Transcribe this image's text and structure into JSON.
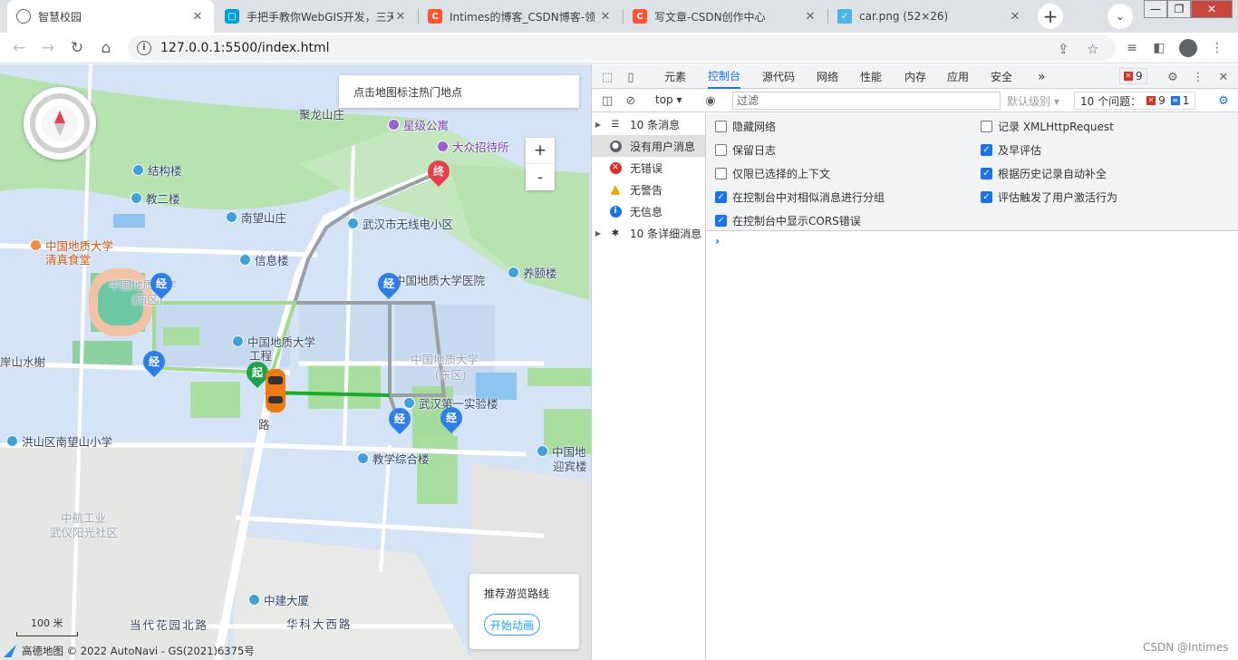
{
  "browser": {
    "tabs": [
      {
        "title": "智慧校园",
        "active": true,
        "favicon": "globe-icon"
      },
      {
        "title": "手把手教你WebGIS开发，三天",
        "favicon": "bilibili-icon"
      },
      {
        "title": "Intimes的博客_CSDN博客-领",
        "favicon": "csdn-icon"
      },
      {
        "title": "写文章-CSDN创作中心",
        "favicon": "csdn-icon"
      },
      {
        "title": "car.png (52×26)",
        "favicon": "image-icon"
      }
    ],
    "close_glyph": "✕",
    "new_tab_glyph": "+",
    "url": "127.0.0.1:5500/index.html",
    "colors": {
      "csdn": "#fc5531",
      "bili": "#00a1d6"
    }
  },
  "map": {
    "hint": "点击地图标注热门地点",
    "zoom_in": "+",
    "zoom_out": "-",
    "route_card": {
      "title": "推荐游览路线",
      "button": "开始动画"
    },
    "scale": "100 米",
    "copyright": "高德地图 © 2022 AutoNavi - GS(2021)6375号",
    "pois": [
      {
        "label": "聚龙山庄",
        "style": "plain"
      },
      {
        "label": "星级公寓",
        "style": "purple"
      },
      {
        "label": "大众招待所",
        "style": "purple"
      },
      {
        "label": "结构楼",
        "style": "blue"
      },
      {
        "label": "教二楼",
        "style": "blue"
      },
      {
        "label": "南望山庄",
        "style": "blue"
      },
      {
        "label": "武汉市无线电小区",
        "style": "blue"
      },
      {
        "label": "中国地质大学",
        "style": "orange"
      },
      {
        "label": "清真食堂",
        "style": "orange"
      },
      {
        "label": "信息楼",
        "style": "blue"
      },
      {
        "label": "中国地质大学医院",
        "style": "plain"
      },
      {
        "label": "养颐楼",
        "style": "blue"
      },
      {
        "label": "中国地质大学",
        "style": "plain"
      },
      {
        "label": "工程",
        "style": "plain"
      },
      {
        "label": "岸山水榭",
        "style": "plain"
      },
      {
        "label": "中国地质大学",
        "style": "gray"
      },
      {
        "label": "(西区)",
        "style": "gray"
      },
      {
        "label": "(东区)",
        "style": "gray"
      },
      {
        "label": "武汉第一实验楼",
        "style": "blue"
      },
      {
        "label": "洪山区南望山小学",
        "style": "blue"
      },
      {
        "label": "教学综合楼",
        "style": "blue"
      },
      {
        "label": "中国地",
        "style": "blue"
      },
      {
        "label": "迎宾楼",
        "style": "plain"
      },
      {
        "label": "中航工业",
        "style": "gray"
      },
      {
        "label": "武仪阳光社区",
        "style": "gray"
      },
      {
        "label": "中建大厦",
        "style": "blue"
      },
      {
        "label": "当代花园北路",
        "style": "plain"
      },
      {
        "label": "华科大西路",
        "style": "plain"
      },
      {
        "label": "路",
        "style": "plain"
      }
    ],
    "markers": {
      "end": "终",
      "start": "起",
      "via": "经"
    }
  },
  "devtools": {
    "tabs": [
      "元素",
      "控制台",
      "源代码",
      "网络",
      "性能",
      "内存",
      "应用",
      "安全"
    ],
    "more_tabs": "»",
    "active_tab": "控制台",
    "error_count": "9",
    "context": "top",
    "filter_placeholder": "过滤",
    "levels": "默认级别",
    "issues": {
      "label": "10 个问题：",
      "errors": "9",
      "info": "1"
    },
    "sidebar": [
      {
        "label": "10 条消息",
        "icon": "list-icon",
        "expandable": true
      },
      {
        "label": "没有用户消息",
        "icon": "user-icon",
        "selected": true
      },
      {
        "label": "无错误",
        "icon": "error-icon"
      },
      {
        "label": "无警告",
        "icon": "warning-icon"
      },
      {
        "label": "无信息",
        "icon": "info-icon"
      },
      {
        "label": "10 条详细消息",
        "icon": "bug-icon",
        "expandable": true
      }
    ],
    "settings_left": [
      {
        "label": "隐藏网络",
        "checked": false
      },
      {
        "label": "保留日志",
        "checked": false
      },
      {
        "label": "仅限已选择的上下文",
        "checked": false
      },
      {
        "label": "在控制台中对相似消息进行分组",
        "checked": true
      },
      {
        "label": "在控制台中显示CORS错误",
        "checked": true
      }
    ],
    "settings_right": [
      {
        "label": "记录 XMLHttpRequest",
        "checked": false
      },
      {
        "label": "及早评估",
        "checked": true
      },
      {
        "label": "根据历史记录自动补全",
        "checked": true
      },
      {
        "label": "评估触发了用户激活行为",
        "checked": true
      }
    ],
    "prompt": "›"
  },
  "watermark": "CSDN @Intimes"
}
